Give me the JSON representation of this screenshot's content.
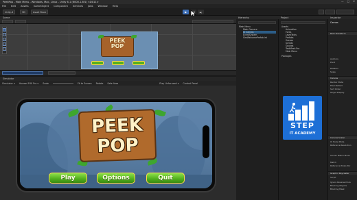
{
  "window": {
    "title": "PeekPop - Main Menu - Windows, Mac, Linux - Unity 6.1 (6000.1.8f1) <DX11>",
    "controls": [
      "—",
      "□",
      "✕"
    ]
  },
  "menu": [
    "File",
    "Edit",
    "Assets",
    "GameObject",
    "Component",
    "Services",
    "Jobs",
    "Window",
    "Help"
  ],
  "toolbar": {
    "account": "Unity-4",
    "cloud": "3D",
    "asset_store": "Asset Store",
    "play_icon": "▶",
    "pause_icon": "❚❚",
    "step_icon": "▶|"
  },
  "scene": {
    "tab": "Scene"
  },
  "simulator": {
    "tab": "Simulator",
    "toolbar": [
      "Simulator ▾",
      "Huawei P40 Pro ▾",
      "Scale",
      "Fit to Screen",
      "Rotate",
      "Safe Area",
      "Play Unfocused ▾",
      "Control Panel"
    ]
  },
  "game": {
    "title_top": "PEEK",
    "title_bottom": "POP",
    "buttons": {
      "play": "Play",
      "options": "Options",
      "quit": "Quit"
    }
  },
  "hierarchy": {
    "tab": "Hierarchy",
    "items": [
      "Main Menu",
      "Main Camera",
      "UI Canvas",
      "EventSystem",
      "SimWelcomePrefab.int"
    ]
  },
  "project": {
    "tab": "Project",
    "items": [
      "Assets",
      "Animation",
      "Fonts",
      "LevelTexts",
      "Prefabs",
      "Scenes",
      "Scripts",
      "Sounds",
      "TextMesh Pro",
      "Main Menu",
      "Packages"
    ]
  },
  "inspector": {
    "tab": "Inspector",
    "object": "Canvas",
    "sections": [
      "Rect Transform",
      "Canvas",
      "Canvas Scaler",
      "Graphic Raycaster"
    ],
    "rows": [
      "Anchors",
      "Pivot",
      "Rotation",
      "Scale",
      "Render Mode",
      "Pixel Perfect",
      "Sort Order",
      "Target Display",
      "UI Scale Mode",
      "Reference Resolution",
      "Screen Match Mode",
      "Match",
      "Reference Pixels Per",
      "Script",
      "Ignore Reversed Gra",
      "Blocking Objects",
      "Blocking Mask"
    ]
  },
  "logo": {
    "top": "STEP",
    "bottom": "IT ACADEMY"
  }
}
